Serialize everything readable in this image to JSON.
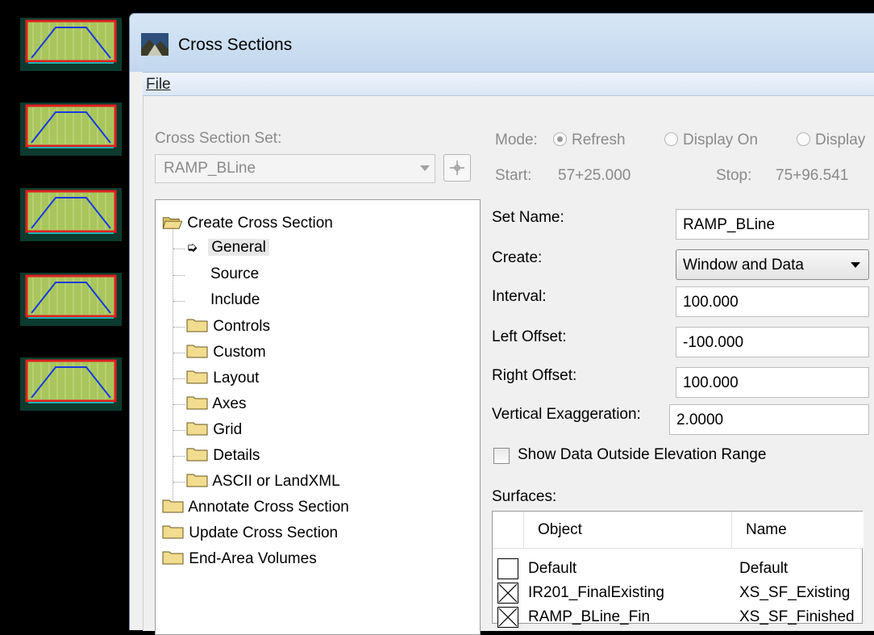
{
  "window": {
    "title": "Cross Sections"
  },
  "menu": {
    "file": "File"
  },
  "cross_section_set": {
    "label": "Cross Section Set:",
    "value": "RAMP_BLine"
  },
  "mode": {
    "label": "Mode:",
    "options": [
      "Refresh",
      "Display On",
      "Display"
    ],
    "selected": "Refresh"
  },
  "range": {
    "start_label": "Start:",
    "start_value": "57+25.000",
    "stop_label": "Stop:",
    "stop_value": "75+96.541"
  },
  "tree": {
    "root": "Create Cross Section",
    "children": [
      "General",
      "Source",
      "Include",
      "Controls",
      "Custom",
      "Layout",
      "Axes",
      "Grid",
      "Details",
      "ASCII or LandXML"
    ],
    "others": [
      "Annotate Cross Section",
      "Update Cross Section",
      "End-Area Volumes"
    ],
    "selected": "General"
  },
  "form": {
    "set_name_label": "Set Name:",
    "set_name_value": "RAMP_BLine",
    "create_label": "Create:",
    "create_value": "Window and Data",
    "interval_label": "Interval:",
    "interval_value": "100.000",
    "left_offset_label": "Left Offset:",
    "left_offset_value": "-100.000",
    "right_offset_label": "Right Offset:",
    "right_offset_value": "100.000",
    "vert_exag_label": "Vertical Exaggeration:",
    "vert_exag_value": "2.0000",
    "show_data_label": "Show Data Outside Elevation Range",
    "show_data_checked": false
  },
  "surfaces": {
    "label": "Surfaces:",
    "columns": [
      "Object",
      "Name"
    ],
    "rows": [
      {
        "object": "Default",
        "name": "Default",
        "checked": false
      },
      {
        "object": "IR201_FinalExisting",
        "name": "XS_SF_Existing",
        "checked": true
      },
      {
        "object": "RAMP_BLine_Fin",
        "name": "XS_SF_Finished",
        "checked": true
      }
    ]
  },
  "colors": {
    "titlebar": "#c2d7ee",
    "folder": "#f1dc8f",
    "thumb_border": "#e02020",
    "thumb_fill": "#a8c65c",
    "thumb_line": "#1a3adf"
  }
}
